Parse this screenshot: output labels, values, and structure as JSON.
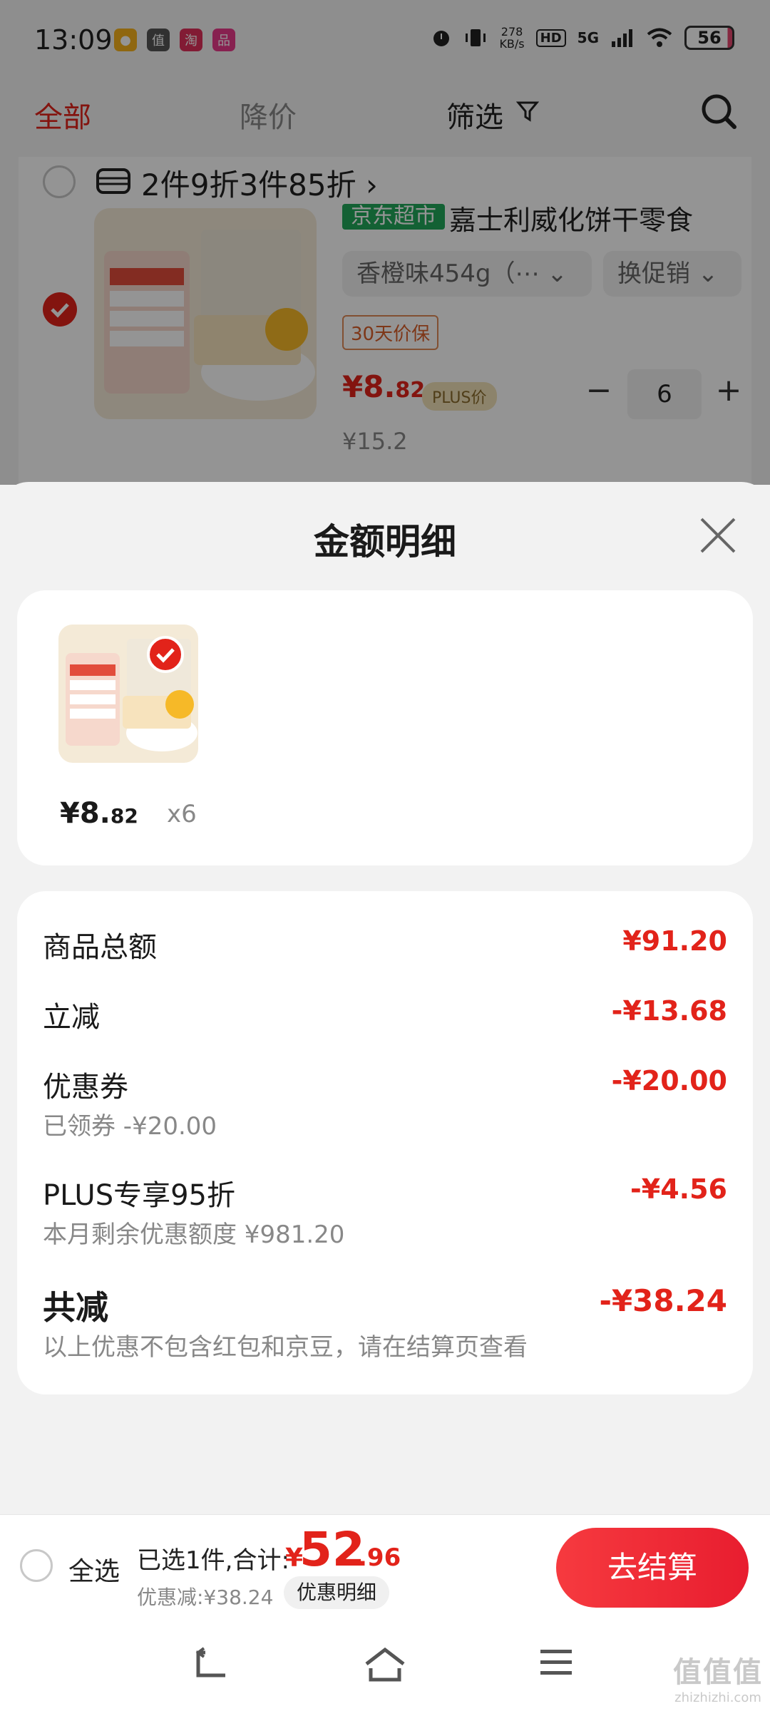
{
  "status": {
    "time": "13:09",
    "net_speed_value": "278",
    "net_speed_unit": "KB/s",
    "hd": "HD",
    "signal": "5G",
    "battery": "56"
  },
  "cart": {
    "tabs": {
      "all": "全部",
      "price_drop": "降价",
      "filter": "筛选"
    },
    "promo": {
      "text": "2件9折3件85折 ›"
    },
    "item": {
      "store_tag": "京东超市",
      "name": "嘉士利威化饼干零食",
      "spec": "香橙味454g（⋯ ⌄",
      "promo_select": "换促销 ⌄",
      "guarantee": "30天价保",
      "price_int": "¥8.",
      "price_dec": "82",
      "plus_tag": "PLUS价",
      "quantity": "6",
      "minus": "−",
      "plus": "+",
      "old_price": "¥15.2"
    }
  },
  "sheet": {
    "title": "金额明细",
    "goods": {
      "price_int": "¥8.",
      "price_dec": "82",
      "qty": "x6"
    },
    "rows": {
      "total": {
        "label": "商品总额",
        "value": "¥91.20"
      },
      "instant": {
        "label": "立减",
        "value": "-¥13.68"
      },
      "coupon": {
        "label": "优惠券",
        "sub": "已领券 -¥20.00",
        "value": "-¥20.00"
      },
      "plus": {
        "label": "PLUS专享95折",
        "sub": "本月剩余优惠额度 ¥981.20",
        "value": "-¥4.56"
      },
      "sum": {
        "label": "共减",
        "sub": "以上优惠不包含红包和京豆，请在结算页查看",
        "value": "-¥38.24"
      }
    }
  },
  "checkout": {
    "select_all": "全选",
    "selected_text": "已选1件,合计:",
    "yen": "¥",
    "total_int": "52",
    "total_dec": ".96",
    "saved": "优惠减:¥38.24",
    "detail_link": "优惠明细",
    "pay": "去结算"
  },
  "watermark": {
    "big": "值值值",
    "small": "zhizhizhi.com"
  },
  "colors": {
    "accent": "#e2231a",
    "store_green": "#21a85a",
    "pay_gradient_start": "#f63a3f"
  }
}
